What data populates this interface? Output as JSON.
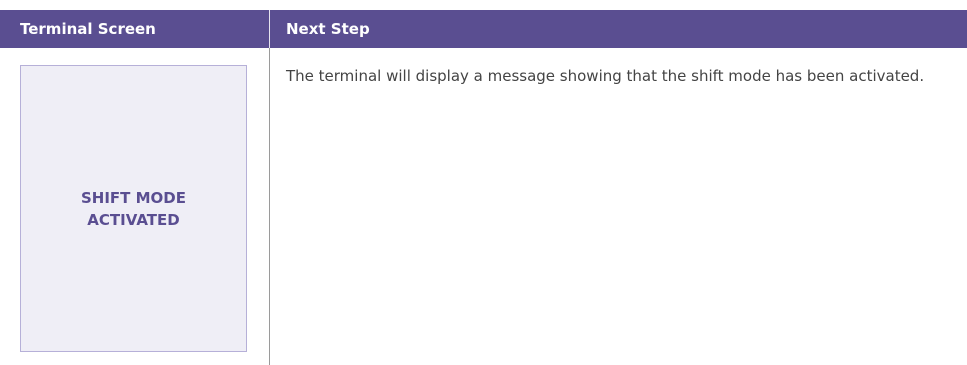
{
  "table": {
    "headers": {
      "terminal_screen": "Terminal Screen",
      "next_step": "Next Step"
    },
    "rows": [
      {
        "screen_text": "SHIFT MODE ACTIVATED",
        "step_text": "The terminal will display a message showing that the shift mode has been activated."
      }
    ]
  },
  "colors": {
    "header_bg": "#5a4e91",
    "screen_bg": "#efeef6",
    "screen_border": "#b6b0d8",
    "screen_text": "#5a4e91",
    "body_text": "#444444"
  }
}
